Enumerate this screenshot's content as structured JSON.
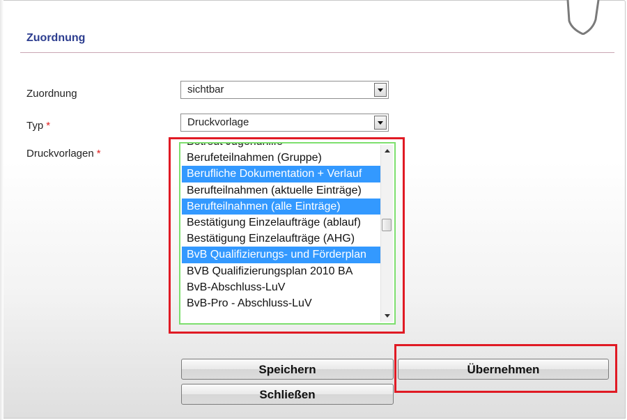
{
  "section": {
    "title": "Zuordnung"
  },
  "form": {
    "zuordnung": {
      "label": "Zuordnung",
      "value": "sichtbar"
    },
    "typ": {
      "label": "Typ",
      "required_mark": "*",
      "value": "Druckvorlage"
    },
    "druckvorlagen": {
      "label": "Druckvorlagen",
      "required_mark": "*",
      "items": [
        {
          "label": "Betreut Jugendhilfe",
          "selected": false
        },
        {
          "label": "Berufeteilnahmen (Gruppe)",
          "selected": false
        },
        {
          "label": "Berufliche Dokumentation + Verlauf",
          "selected": true
        },
        {
          "label": "Berufteilnahmen (aktuelle Einträge)",
          "selected": false
        },
        {
          "label": "Berufteilnahmen (alle Einträge)",
          "selected": true
        },
        {
          "label": "Bestätigung Einzelaufträge (ablauf)",
          "selected": false
        },
        {
          "label": "Bestätigung Einzelaufträge (AHG)",
          "selected": false
        },
        {
          "label": "BvB Qualifizierungs- und Förderplan",
          "selected": true
        },
        {
          "label": "BVB Qualifizierungsplan 2010 BA",
          "selected": false
        },
        {
          "label": "BvB-Abschluss-LuV",
          "selected": false
        },
        {
          "label": "BvB-Pro - Abschluss-LuV",
          "selected": false
        }
      ]
    }
  },
  "buttons": {
    "save": "Speichern",
    "apply": "Übernehmen",
    "close": "Schließen"
  },
  "colors": {
    "title": "#2c3d8f",
    "required": "#e02020",
    "selection": "#3399ff",
    "highlight_box": "#e01a24",
    "listbox_border": "#7ddf6e"
  }
}
